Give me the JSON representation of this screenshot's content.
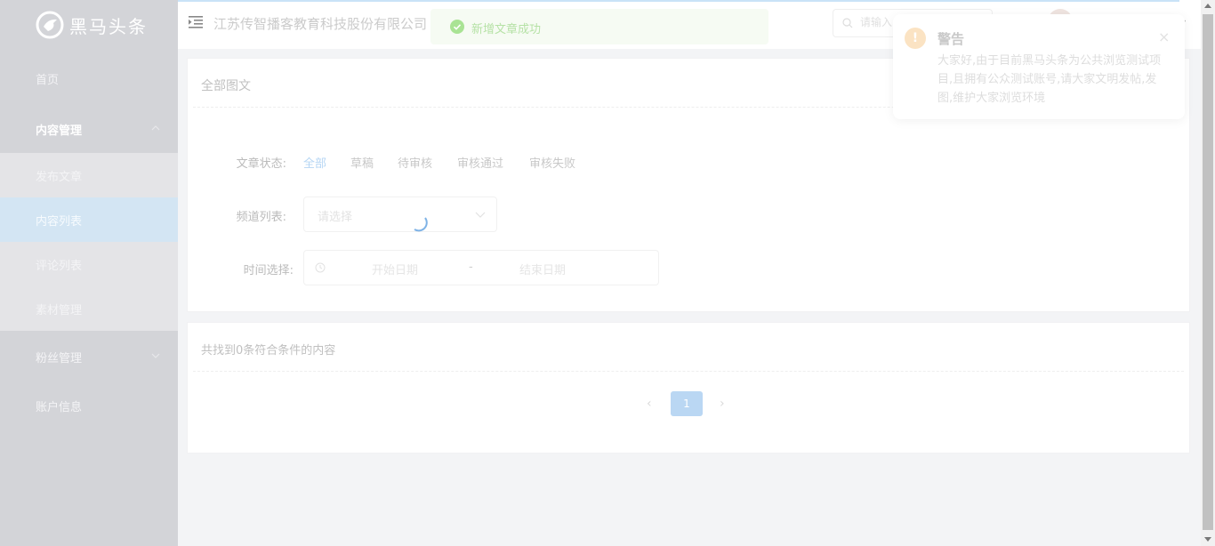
{
  "sidebar": {
    "logo_text": "黑马头条",
    "items": [
      {
        "label": "首页"
      },
      {
        "label": "内容管理"
      },
      {
        "label": "发布文章"
      },
      {
        "label": "内容列表"
      },
      {
        "label": "评论列表"
      },
      {
        "label": "素材管理"
      },
      {
        "label": "粉丝管理"
      },
      {
        "label": "账户信息"
      }
    ]
  },
  "header": {
    "company": "江苏传智播客教育科技股份有限公司",
    "search_placeholder": "请输入"
  },
  "message": {
    "text": "新增文章成功"
  },
  "filter": {
    "title": "全部图文",
    "status_label": "文章状态:",
    "status_options": [
      "全部",
      "草稿",
      "待审核",
      "审核通过",
      "审核失败"
    ],
    "channel_label": "频道列表:",
    "channel_placeholder": "请选择",
    "time_label": "时间选择:",
    "start_placeholder": "开始日期",
    "range_separator": "-",
    "end_placeholder": "结束日期"
  },
  "results": {
    "count_text": "共找到0条符合条件的内容",
    "page_prev": "‹",
    "current_page": "1",
    "page_next": "›"
  },
  "notification": {
    "icon": "!",
    "title": "警告",
    "close": "×",
    "body": "大家好,由于目前黑马头条为公共浏览测试项目,且拥有公众测试账号,请大家文明发帖,发图,维护大家浏览环境"
  },
  "colors": {
    "accent": "#b6d6f4",
    "success": "#b6e2a6",
    "warning": "#fbe3c3",
    "sidebar_bg": "#d3d4d8"
  }
}
